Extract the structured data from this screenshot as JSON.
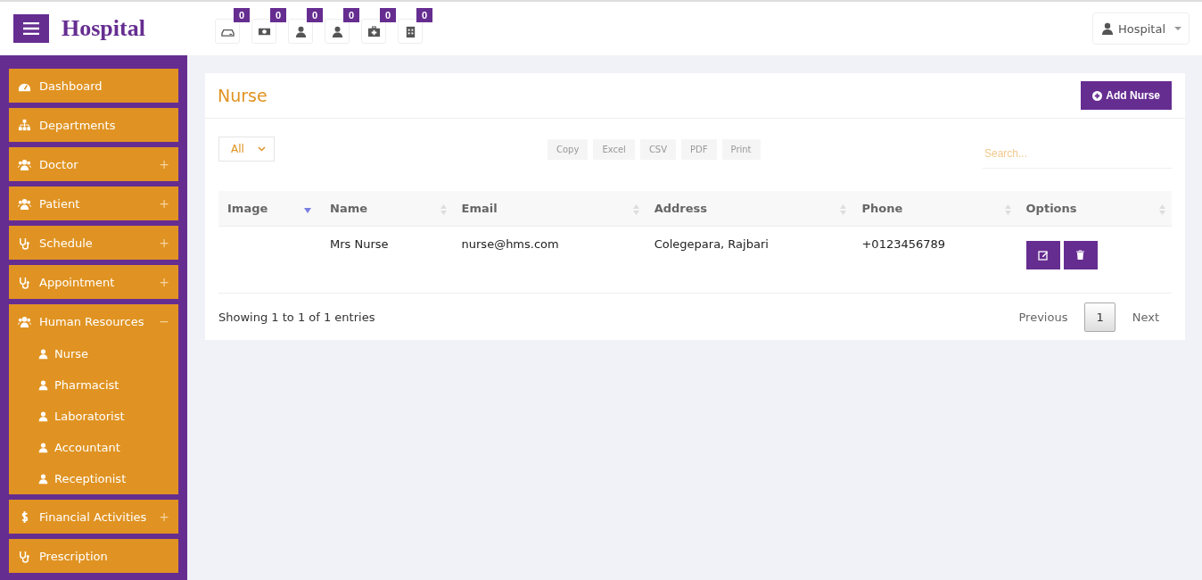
{
  "header": {
    "brand": "Hospital",
    "counters": [
      {
        "kind": "drawer",
        "count": "0"
      },
      {
        "kind": "money",
        "count": "0"
      },
      {
        "kind": "user",
        "count": "0"
      },
      {
        "kind": "user",
        "count": "0"
      },
      {
        "kind": "medkit",
        "count": "0"
      },
      {
        "kind": "building",
        "count": "0"
      }
    ],
    "user_menu": {
      "label": "Hospital"
    }
  },
  "sidebar": {
    "items": [
      {
        "kind": "gauge",
        "label": "Dashboard"
      },
      {
        "kind": "sitemap",
        "label": "Departments"
      },
      {
        "kind": "users",
        "label": "Doctor",
        "toggle": "+"
      },
      {
        "kind": "users",
        "label": "Patient",
        "toggle": "+"
      },
      {
        "kind": "stethoscope",
        "label": "Schedule",
        "toggle": "+"
      },
      {
        "kind": "stethoscope",
        "label": "Appointment",
        "toggle": "+"
      },
      {
        "kind": "users",
        "label": "Human Resources",
        "toggle": "−",
        "children": [
          {
            "kind": "user",
            "label": "Nurse"
          },
          {
            "kind": "user",
            "label": "Pharmacist"
          },
          {
            "kind": "user",
            "label": "Laboratorist"
          },
          {
            "kind": "user",
            "label": "Accountant"
          },
          {
            "kind": "user",
            "label": "Receptionist"
          }
        ]
      },
      {
        "kind": "dollar",
        "label": "Financial Activities",
        "toggle": "+"
      },
      {
        "kind": "stethoscope",
        "label": "Prescription"
      }
    ]
  },
  "panel": {
    "title": "Nurse",
    "add_button": "Add Nurse",
    "length_select": "All",
    "export_buttons": [
      "Copy",
      "Excel",
      "CSV",
      "PDF",
      "Print"
    ],
    "search": {
      "placeholder": "Search..."
    },
    "table": {
      "columns": [
        {
          "label": "Image",
          "sorted": true
        },
        {
          "label": "Name",
          "sorted": false
        },
        {
          "label": "Email",
          "sorted": false
        },
        {
          "label": "Address",
          "sorted": false
        },
        {
          "label": "Phone",
          "sorted": false
        },
        {
          "label": "Options",
          "sorted": false
        }
      ],
      "rows": [
        {
          "name": "Mrs Nurse",
          "email": "nurse@hms.com",
          "address": "Colegepara, Rajbari",
          "phone": "+0123456789"
        }
      ]
    },
    "info": "Showing 1 to 1 of 1 entries",
    "pagination": [
      {
        "label": "Previous",
        "kind": "nav",
        "selected": false
      },
      {
        "label": "1",
        "kind": "page",
        "selected": true
      },
      {
        "label": "Next",
        "kind": "nav",
        "selected": false
      }
    ]
  }
}
